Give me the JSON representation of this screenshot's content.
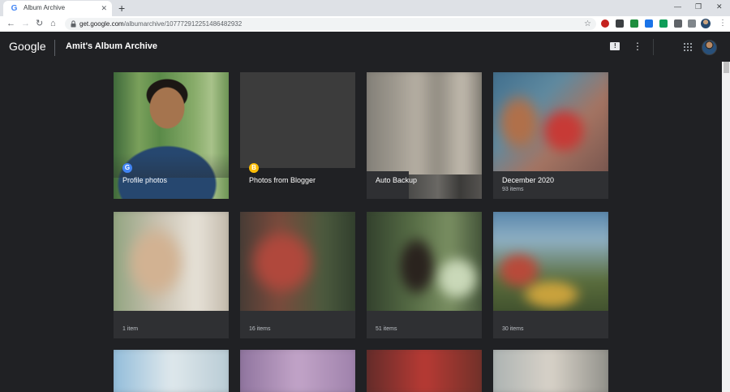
{
  "browser": {
    "tab_title": "Album Archive",
    "tab_favicon": "G",
    "url_host": "get.google.com",
    "url_path": "/albumarchive/107772912251486482932",
    "new_tab_icon": "plus-icon",
    "close_icon": "close-icon"
  },
  "app": {
    "logo_text": "Google",
    "title": "Amit's Album Archive"
  },
  "albums_row1": [
    {
      "name": "Profile photos",
      "count": "",
      "badge": "G"
    },
    {
      "name": "Photos from Blogger",
      "count": "",
      "badge": "B"
    },
    {
      "name": "Auto Backup",
      "count": ""
    },
    {
      "name": "December 2020",
      "count": "93 items"
    }
  ],
  "albums_row2": [
    {
      "count": "1 item"
    },
    {
      "count": "16 items"
    },
    {
      "count": "51 items"
    },
    {
      "count": "30 items"
    }
  ],
  "colors": {
    "page_bg": "#202124",
    "card_bg": "#2f3033",
    "accent_blue": "#4285f4",
    "blogger_yellow": "#fbbc04"
  }
}
